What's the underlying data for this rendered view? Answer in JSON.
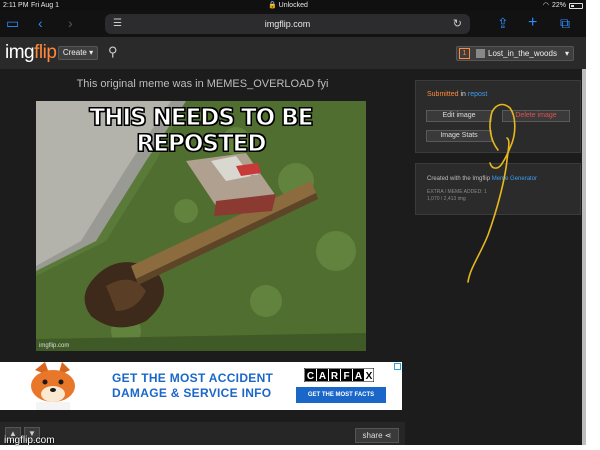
{
  "status_bar": {
    "time": "2:11 PM",
    "date": "Fri Aug 1",
    "center": "Unlocked",
    "battery": "22%"
  },
  "browser": {
    "url": "imgflip.com"
  },
  "header": {
    "logo_main": "img",
    "logo_accent": "flip",
    "create_label": "Create",
    "notification_count": "1",
    "username": "Lost_in_the_woods"
  },
  "post": {
    "caption": "This original meme was in MEMES_OVERLOAD fyi",
    "meme_text": "THIS NEEDS TO BE REPOSTED",
    "meme_watermark": "imgflip.com"
  },
  "ad": {
    "headline_line1": "GET THE MOST ACCIDENT",
    "headline_line2": "DAMAGE & SERVICE INFO",
    "brand": "CARFAX",
    "cta": "GET THE MOST FACTS"
  },
  "bottom_bar": {
    "share_label": "share"
  },
  "site_watermark": "imgflip.com",
  "sidebar": {
    "submitted_prefix": "Submitted",
    "submitted_in": "in",
    "stream": "repost",
    "edit_label": "Edit image",
    "delete_label": "Delete image",
    "stats_label": "Image Stats",
    "created_prefix": "Created with the Imgflip",
    "created_link": "Meme Generator",
    "meta_line1": "EXTRA / MEME ADDED: 1",
    "meta_line2": "1,070 / 2,413 img"
  },
  "colors": {
    "accent": "#ff8a3c",
    "link": "#3d9cf0",
    "delete": "#e05050",
    "annotation": "#e6b81e",
    "ad_blue": "#1a66c9"
  },
  "icons": {
    "tabs": "sidebar-icon",
    "back": "back-arrow-icon",
    "forward": "forward-arrow-icon",
    "share": "share-icon",
    "new_tab": "plus-icon",
    "tab_overview": "tabs-icon",
    "search": "search-icon",
    "reload": "reload-icon"
  }
}
